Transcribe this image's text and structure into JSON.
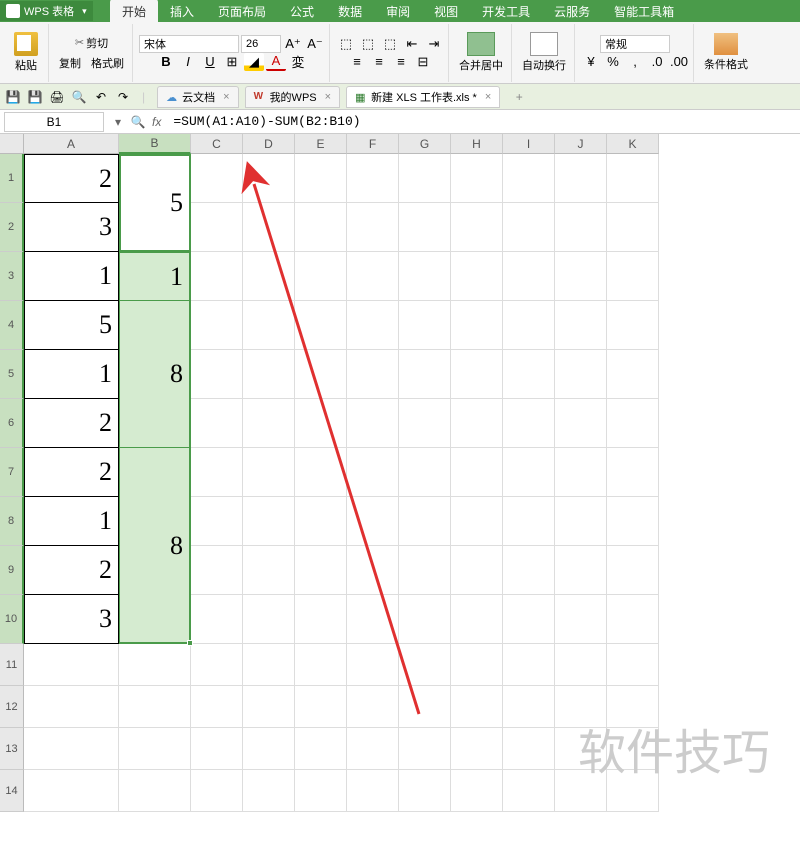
{
  "app": {
    "name": "WPS 表格"
  },
  "menu": {
    "tabs": [
      "开始",
      "插入",
      "页面布局",
      "公式",
      "数据",
      "审阅",
      "视图",
      "开发工具",
      "云服务",
      "智能工具箱"
    ],
    "active": "开始"
  },
  "ribbon": {
    "paste": "粘贴",
    "cut": "剪切",
    "copy": "复制",
    "brush": "格式刷",
    "font_name": "宋体",
    "font_size": "26",
    "merge": "合并居中",
    "wrap": "自动换行",
    "numfmt": "常规",
    "condfmt": "条件格式"
  },
  "doctabs": {
    "cloud": "云文档",
    "mywps": "我的WPS",
    "newxls": "新建 XLS 工作表.xls *"
  },
  "formulabar": {
    "namebox": "B1",
    "fx": "fx",
    "formula": "=SUM(A1:A10)-SUM(B2:B10)"
  },
  "columns": [
    "A",
    "B",
    "C",
    "D",
    "E",
    "F",
    "G",
    "H",
    "I",
    "J",
    "K"
  ],
  "rows": [
    "1",
    "2",
    "3",
    "4",
    "5",
    "6",
    "7",
    "8",
    "9",
    "10",
    "11",
    "12",
    "13",
    "14"
  ],
  "cells": {
    "A": [
      "2",
      "3",
      "1",
      "5",
      "1",
      "2",
      "2",
      "1",
      "2",
      "3"
    ],
    "B": {
      "b1": "5",
      "b3": "1",
      "b4": "8",
      "b7": "8"
    }
  },
  "row_heights": {
    "data": 49,
    "empty": 42
  },
  "watermark": "软件技巧"
}
